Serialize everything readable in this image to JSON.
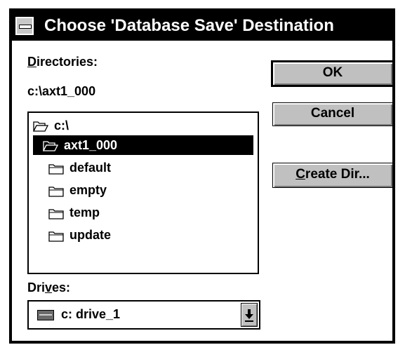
{
  "window": {
    "title": "Choose 'Database Save' Destination"
  },
  "directories": {
    "label_underlined": "D",
    "label_rest": "irectories:",
    "current_path": "c:\\axt1_000",
    "items": [
      {
        "name": "c:\\",
        "state": "open",
        "selected": false
      },
      {
        "name": "axt1_000",
        "state": "open",
        "selected": true
      },
      {
        "name": "default",
        "state": "closed",
        "selected": false
      },
      {
        "name": "empty",
        "state": "closed",
        "selected": false
      },
      {
        "name": "temp",
        "state": "closed",
        "selected": false
      },
      {
        "name": "update",
        "state": "closed",
        "selected": false
      }
    ]
  },
  "buttons": {
    "ok": "OK",
    "cancel": "Cancel",
    "create_dir_underlined": "C",
    "create_dir_rest": "reate Dir..."
  },
  "drives": {
    "label_before": "Dri",
    "label_underlined": "v",
    "label_after": "es:",
    "selected": "c: drive_1"
  },
  "icons": {
    "system_menu": "system-menu-icon",
    "folder_open": "open-folder-icon",
    "folder_closed": "folder-icon",
    "drive": "hard-drive-icon",
    "dropdown": "down-arrow-icon"
  }
}
